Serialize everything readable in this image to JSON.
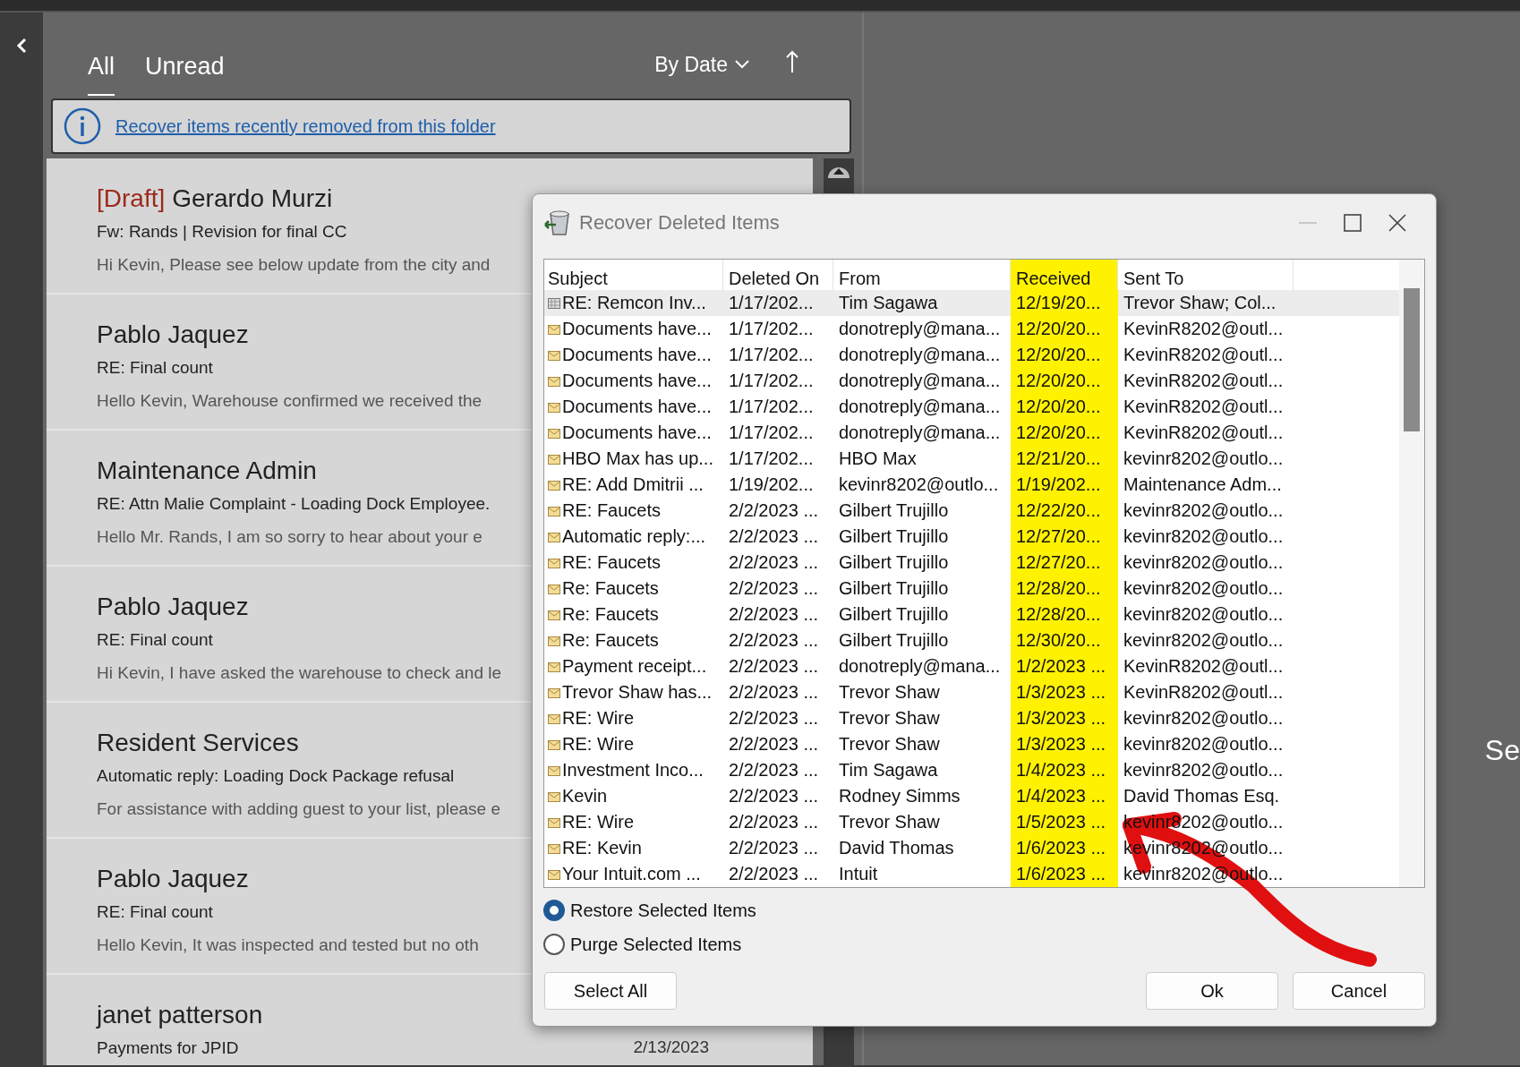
{
  "mail_list": {
    "tabs": [
      {
        "label": "All",
        "selected": true
      },
      {
        "label": "Unread",
        "selected": false
      }
    ],
    "sort": {
      "label": "By Date"
    },
    "info_bar": {
      "link": "Recover items recently removed from this folder"
    },
    "messages": [
      {
        "draft": "[Draft]",
        "sender": "Gerardo Murzi",
        "subject": "Fw: Rands | Revision for final CC",
        "preview": "Hi Kevin,  Please see below update from the city and"
      },
      {
        "sender": "Pablo Jaquez",
        "subject": "RE: Final count",
        "preview": "Hello Kevin,   Warehouse confirmed we received the"
      },
      {
        "sender": "Maintenance Admin",
        "subject": "RE: Attn Malie Complaint - Loading Dock Employee.",
        "preview": "Hello Mr. Rands,   I am so sorry to hear about your e"
      },
      {
        "sender": "Pablo Jaquez",
        "subject": "RE: Final count",
        "preview": "Hi Kevin, I have asked the warehouse to check and le"
      },
      {
        "sender": "Resident Services",
        "subject": "Automatic reply: Loading Dock Package refusal",
        "preview": "For assistance with adding guest to your list, please e"
      },
      {
        "sender": "Pablo Jaquez",
        "subject": "RE: Final count",
        "preview": "Hello Kevin,   It was inspected and tested but no oth"
      },
      {
        "sender": "janet patterson",
        "subject": "Payments for JPID",
        "date": "2/13/2023"
      }
    ]
  },
  "dialog": {
    "title": "Recover Deleted Items",
    "columns": [
      {
        "label": "Subject",
        "highlighted": false
      },
      {
        "label": "Deleted On",
        "highlighted": false
      },
      {
        "label": "From",
        "highlighted": false
      },
      {
        "label": "Received",
        "highlighted": true
      },
      {
        "label": "Sent To",
        "highlighted": false
      }
    ],
    "rows": [
      {
        "kind": "meeting",
        "selected": true,
        "cells": [
          "RE: Remcon Inv...",
          "1/17/202...",
          "Tim Sagawa",
          "12/19/20...",
          "Trevor Shaw; Col..."
        ]
      },
      {
        "kind": "mail",
        "selected": false,
        "cells": [
          "Documents have...",
          "1/17/202...",
          "donotreply@mana...",
          "12/20/20...",
          "KevinR8202@outl..."
        ]
      },
      {
        "kind": "mail",
        "selected": false,
        "cells": [
          "Documents have...",
          "1/17/202...",
          "donotreply@mana...",
          "12/20/20...",
          "KevinR8202@outl..."
        ]
      },
      {
        "kind": "mail",
        "selected": false,
        "cells": [
          "Documents have...",
          "1/17/202...",
          "donotreply@mana...",
          "12/20/20...",
          "KevinR8202@outl..."
        ]
      },
      {
        "kind": "mail",
        "selected": false,
        "cells": [
          "Documents have...",
          "1/17/202...",
          "donotreply@mana...",
          "12/20/20...",
          "KevinR8202@outl..."
        ]
      },
      {
        "kind": "mail",
        "selected": false,
        "cells": [
          "Documents have...",
          "1/17/202...",
          "donotreply@mana...",
          "12/20/20...",
          "KevinR8202@outl..."
        ]
      },
      {
        "kind": "mail",
        "selected": false,
        "cells": [
          "HBO Max has up...",
          "1/17/202...",
          "HBO Max",
          "12/21/20...",
          "kevinr8202@outlo..."
        ]
      },
      {
        "kind": "mail",
        "selected": false,
        "cells": [
          "RE: Add Dmitrii ...",
          "1/19/202...",
          "kevinr8202@outlo...",
          "1/19/202...",
          "Maintenance Adm..."
        ]
      },
      {
        "kind": "mail",
        "selected": false,
        "cells": [
          "RE: Faucets",
          "2/2/2023 ...",
          "Gilbert Trujillo",
          "12/22/20...",
          "kevinr8202@outlo..."
        ]
      },
      {
        "kind": "mail",
        "selected": false,
        "cells": [
          "Automatic reply:...",
          "2/2/2023 ...",
          "Gilbert Trujillo",
          "12/27/20...",
          "kevinr8202@outlo..."
        ]
      },
      {
        "kind": "mail",
        "selected": false,
        "cells": [
          "RE: Faucets",
          "2/2/2023 ...",
          "Gilbert Trujillo",
          "12/27/20...",
          "kevinr8202@outlo..."
        ]
      },
      {
        "kind": "mail",
        "selected": false,
        "cells": [
          "Re: Faucets",
          "2/2/2023 ...",
          "Gilbert Trujillo",
          "12/28/20...",
          "kevinr8202@outlo..."
        ]
      },
      {
        "kind": "mail",
        "selected": false,
        "cells": [
          "Re: Faucets",
          "2/2/2023 ...",
          "Gilbert Trujillo",
          "12/28/20...",
          "kevinr8202@outlo..."
        ]
      },
      {
        "kind": "mail",
        "selected": false,
        "cells": [
          "Re: Faucets",
          "2/2/2023 ...",
          "Gilbert Trujillo",
          "12/30/20...",
          "kevinr8202@outlo..."
        ]
      },
      {
        "kind": "mail",
        "selected": false,
        "cells": [
          "Payment receipt...",
          "2/2/2023 ...",
          "donotreply@mana...",
          "1/2/2023 ...",
          "KevinR8202@outl..."
        ]
      },
      {
        "kind": "mail",
        "selected": false,
        "cells": [
          "Trevor Shaw has...",
          "2/2/2023 ...",
          "Trevor Shaw",
          "1/3/2023 ...",
          "KevinR8202@outl..."
        ]
      },
      {
        "kind": "mail",
        "selected": false,
        "cells": [
          "RE: Wire",
          "2/2/2023 ...",
          "Trevor Shaw",
          "1/3/2023 ...",
          "kevinr8202@outlo..."
        ]
      },
      {
        "kind": "mail",
        "selected": false,
        "cells": [
          "RE: Wire",
          "2/2/2023 ...",
          "Trevor Shaw",
          "1/3/2023 ...",
          "kevinr8202@outlo..."
        ]
      },
      {
        "kind": "mail",
        "selected": false,
        "cells": [
          "Investment Inco...",
          "2/2/2023 ...",
          "Tim Sagawa",
          "1/4/2023 ...",
          "kevinr8202@outlo..."
        ]
      },
      {
        "kind": "mail",
        "selected": false,
        "cells": [
          "Kevin",
          "2/2/2023 ...",
          "Rodney Simms",
          "1/4/2023 ...",
          "David Thomas Esq."
        ]
      },
      {
        "kind": "mail",
        "selected": false,
        "cells": [
          "RE: Wire",
          "2/2/2023 ...",
          "Trevor Shaw",
          "1/5/2023 ...",
          "kevinr8202@outlo..."
        ]
      },
      {
        "kind": "mail",
        "selected": false,
        "cells": [
          "RE: Kevin",
          "2/2/2023 ...",
          "David Thomas",
          "1/6/2023 ...",
          "kevinr8202@outlo..."
        ]
      },
      {
        "kind": "mail",
        "selected": false,
        "cells": [
          "Your Intuit.com ...",
          "2/2/2023 ...",
          "Intuit",
          "1/6/2023 ...",
          "kevinr8202@outlo..."
        ]
      }
    ],
    "options": [
      {
        "label": "Restore Selected Items",
        "selected": true
      },
      {
        "label": "Purge Selected Items",
        "selected": false
      }
    ],
    "buttons": [
      {
        "label": "Select All",
        "kind": "left"
      },
      {
        "label": "Ok",
        "kind": "right"
      },
      {
        "label": "Cancel",
        "kind": "right"
      }
    ]
  },
  "reading_pane": {
    "text": "Se"
  }
}
